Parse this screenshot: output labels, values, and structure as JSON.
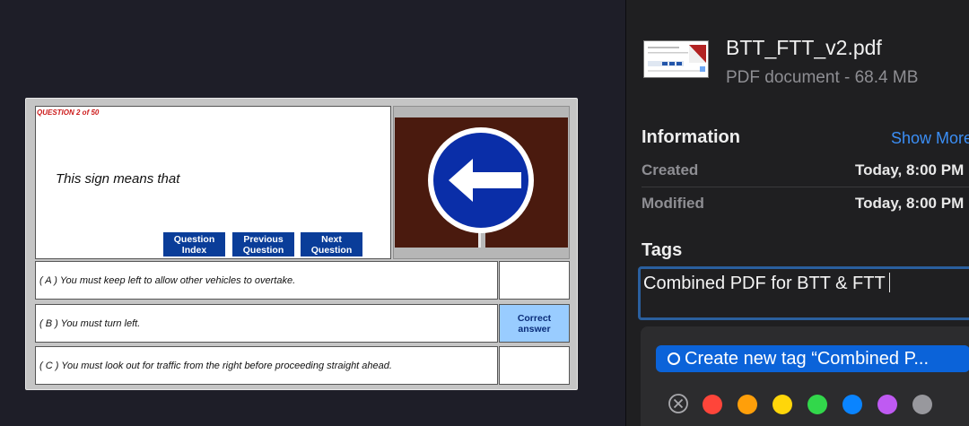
{
  "document": {
    "question_number": "QUESTION 2 of 50",
    "question_text": "This sign means that",
    "nav_buttons": [
      {
        "line1": "Question",
        "line2": "Index"
      },
      {
        "line1": "Previous",
        "line2": "Question"
      },
      {
        "line1": "Next",
        "line2": "Question"
      }
    ],
    "sign_icon": "keep-left-arrow-sign-icon",
    "answers": [
      {
        "text": "( A ) You must keep left to allow other vehicles to overtake.",
        "mark_line1": "",
        "mark_line2": ""
      },
      {
        "text": "( B ) You must turn left.",
        "mark_line1": "Correct",
        "mark_line2": "answer"
      },
      {
        "text": "( C ) You must look out for traffic from the right before proceeding straight ahead.",
        "mark_line1": "",
        "mark_line2": ""
      }
    ],
    "colors": {
      "nav_button": "#0a3d99",
      "correct_highlight": "#99ccff",
      "question_number": "#cc1a1a"
    }
  },
  "info_panel": {
    "file_name": "BTT_FTT_v2.pdf",
    "file_meta": "PDF document - 68.4 MB",
    "information_heading": "Information",
    "show_more": "Show More",
    "created_label": "Created",
    "created_value": "Today, 8:00 PM",
    "modified_label": "Modified",
    "modified_value": "Today, 8:00 PM",
    "tags_heading": "Tags",
    "tag_input_value": "Combined PDF for BTT & FTT",
    "create_tag_label": "Create new tag “Combined P...",
    "tag_colors": [
      "#ff453a",
      "#ff9f0a",
      "#ffd60a",
      "#32d74b",
      "#0a84ff",
      "#bf5af2",
      "#98989d"
    ],
    "accent_color": "#0b63d9"
  }
}
